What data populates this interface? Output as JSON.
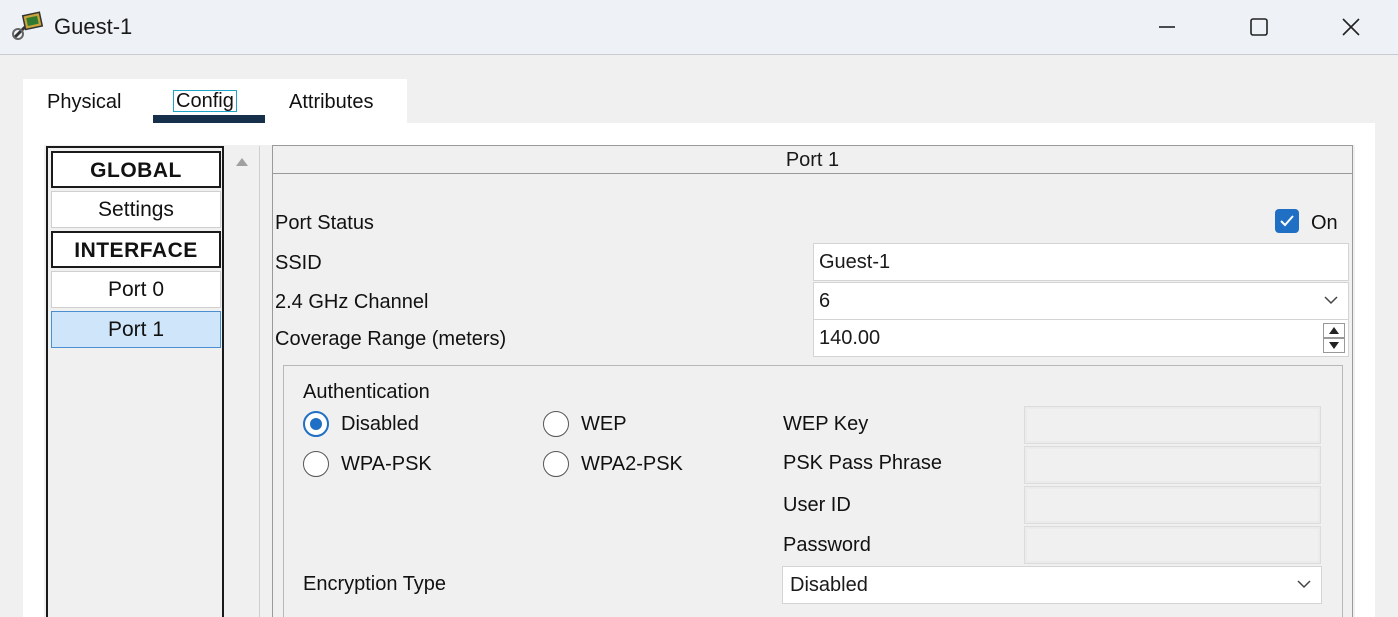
{
  "window": {
    "title": "Guest-1"
  },
  "tabs": [
    {
      "label": "Physical"
    },
    {
      "label": "Config",
      "selected": true
    },
    {
      "label": "Attributes"
    }
  ],
  "sidebar": {
    "items": [
      {
        "label": "GLOBAL",
        "kind": "header"
      },
      {
        "label": "Settings"
      },
      {
        "label": "INTERFACE",
        "kind": "header"
      },
      {
        "label": "Port 0"
      },
      {
        "label": "Port 1",
        "selected": true
      }
    ]
  },
  "port": {
    "title": "Port 1",
    "status_label": "Port Status",
    "status_checked": true,
    "status_value_label": "On",
    "ssid_label": "SSID",
    "ssid_value": "Guest-1",
    "channel_label": "2.4 GHz Channel",
    "channel_value": "6",
    "range_label": "Coverage Range (meters)",
    "range_value": "140.00"
  },
  "auth": {
    "group_label": "Authentication",
    "options": [
      {
        "label": "Disabled",
        "selected": true
      },
      {
        "label": "WEP",
        "selected": false
      },
      {
        "label": "WPA-PSK",
        "selected": false
      },
      {
        "label": "WPA2-PSK",
        "selected": false
      }
    ],
    "wep_key_label": "WEP Key",
    "psk_label": "PSK Pass Phrase",
    "user_id_label": "User ID",
    "password_label": "Password",
    "encryption_label": "Encryption Type",
    "encryption_value": "Disabled"
  },
  "colors": {
    "accent": "#1f6fc4",
    "tab_underline": "#16304c",
    "selected_row": "#cfe5f9"
  }
}
